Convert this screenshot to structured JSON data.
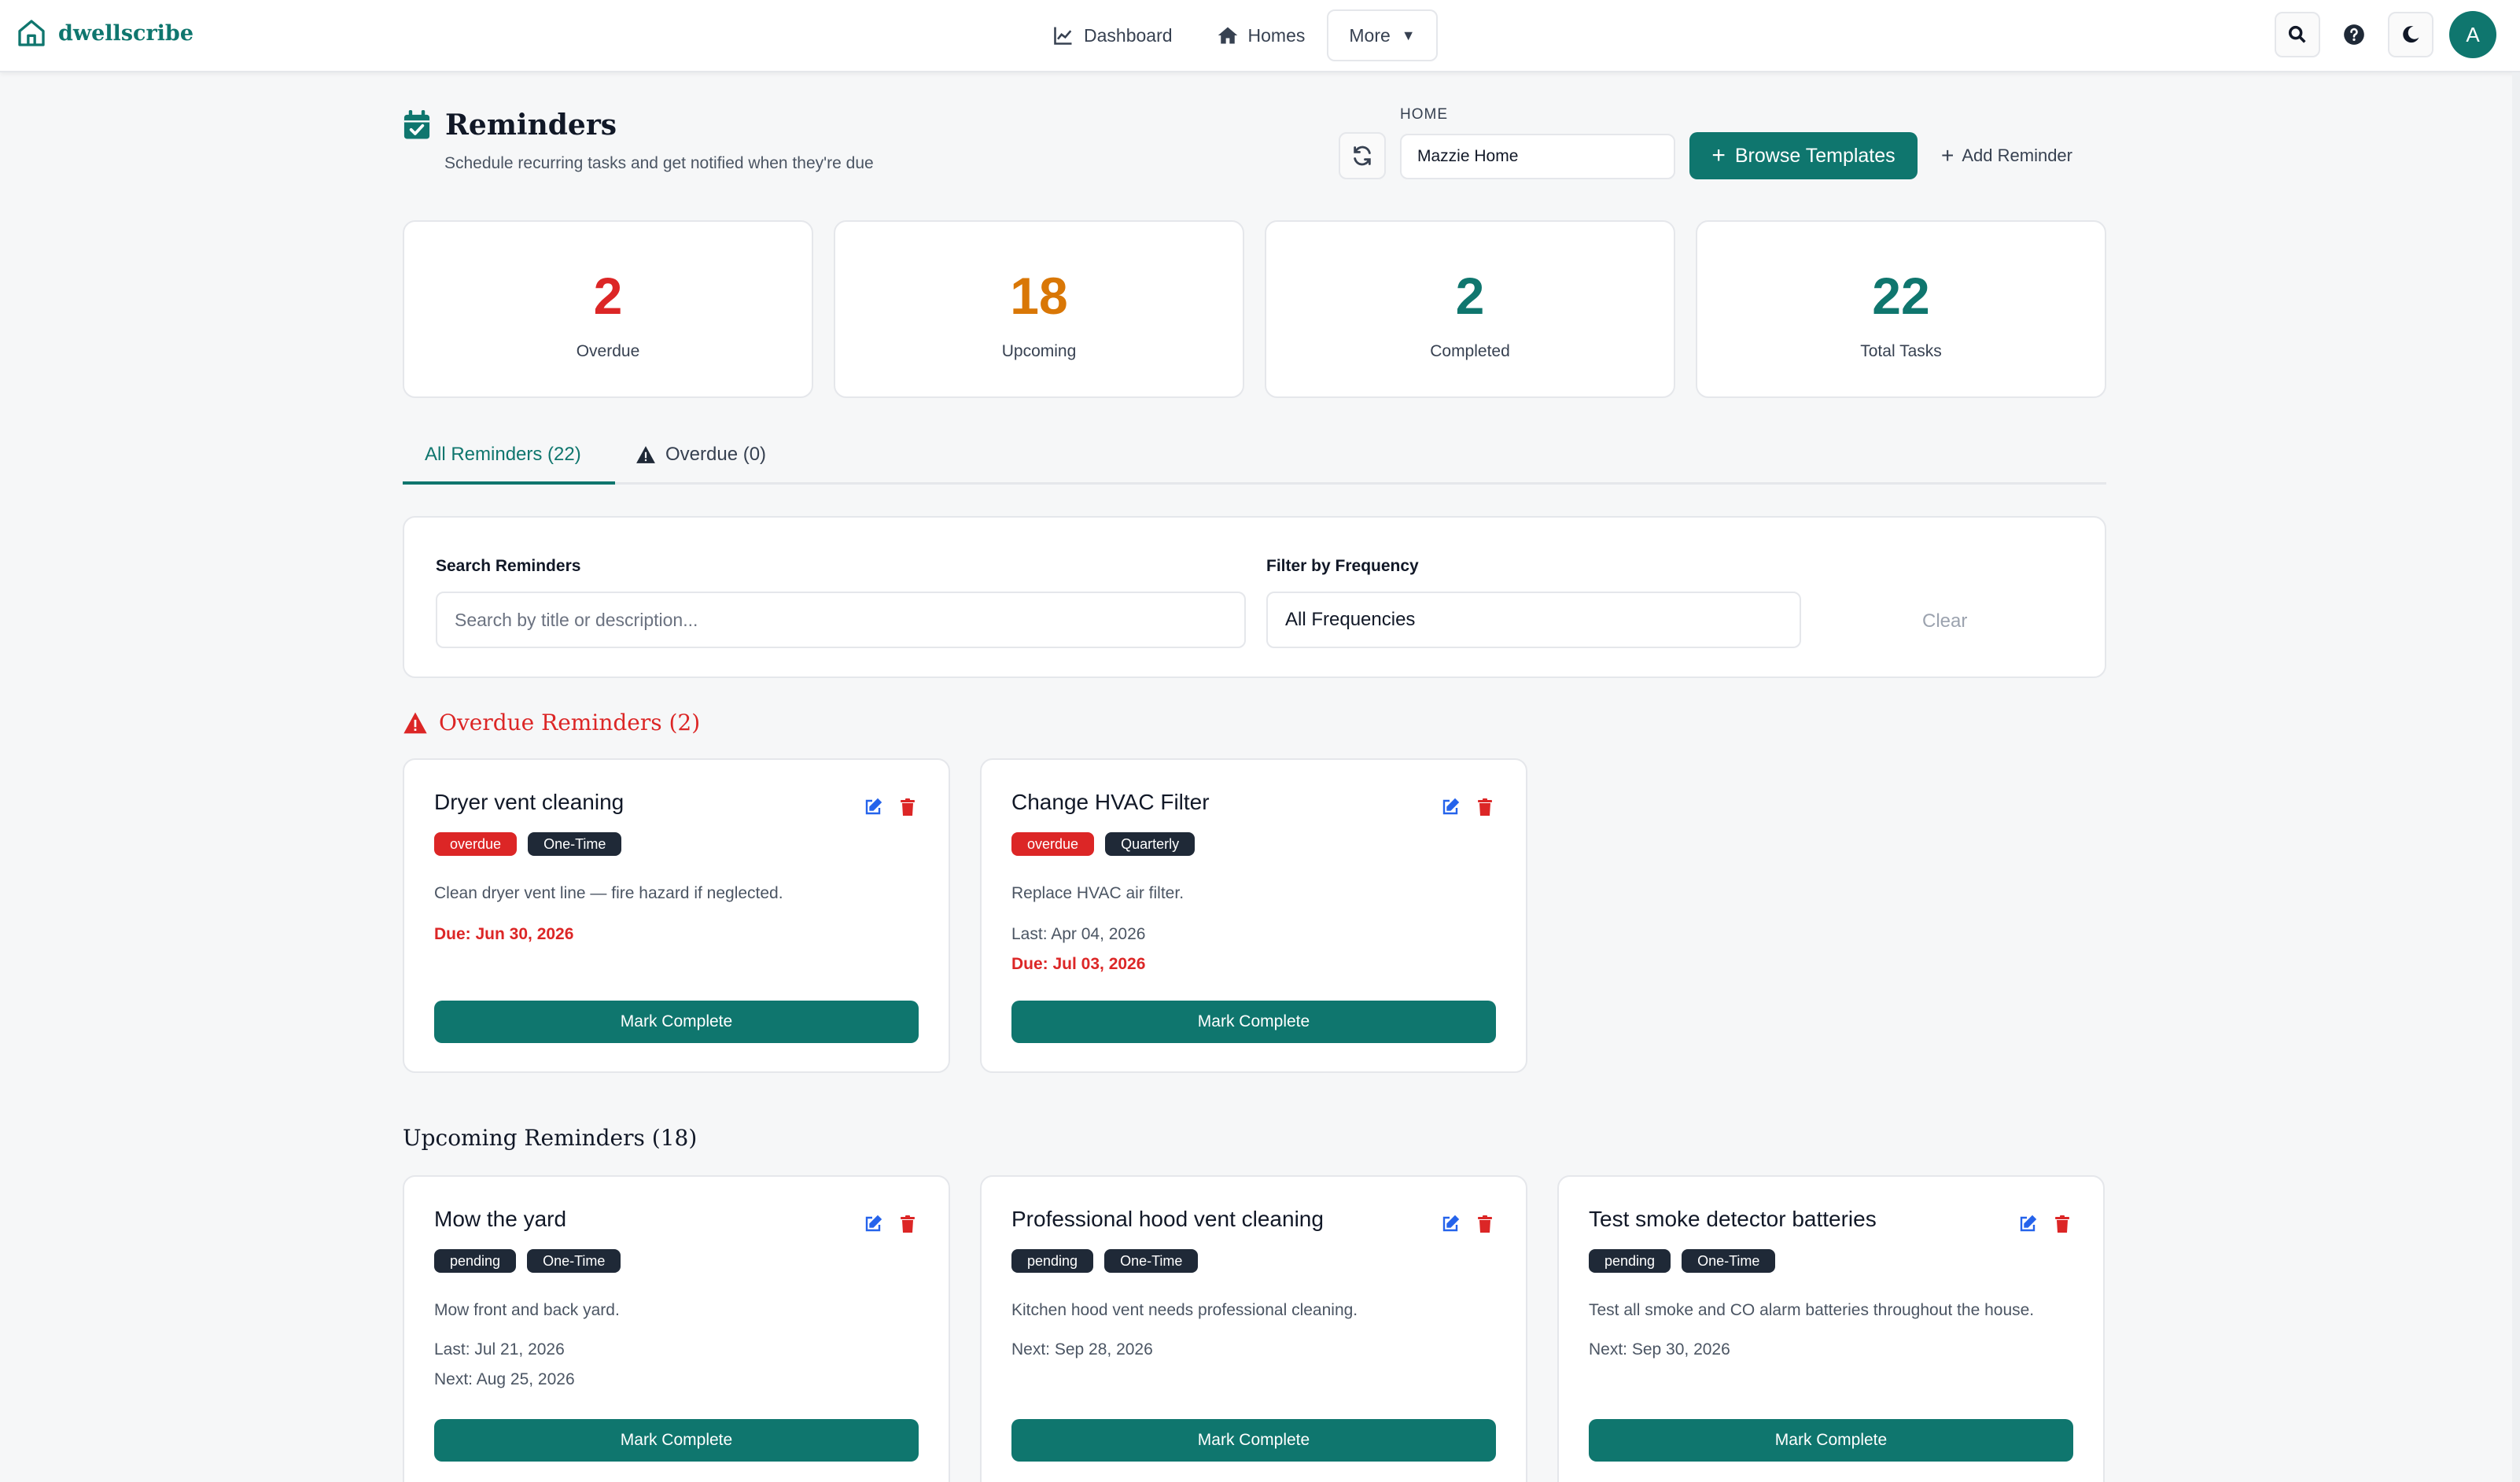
{
  "brand": {
    "name": "dwellscribe"
  },
  "nav": {
    "dashboard": "Dashboard",
    "homes": "Homes",
    "more": "More"
  },
  "user": {
    "initial": "A"
  },
  "header": {
    "title": "Reminders",
    "subtitle": "Schedule recurring tasks and get notified when they're due",
    "home_label": "HOME",
    "home_value": "Mazzie Home",
    "browse_label": "Browse Templates",
    "add_label": "Add Reminder"
  },
  "stats": [
    {
      "value": "2",
      "label": "Overdue",
      "color": "#dc2626"
    },
    {
      "value": "18",
      "label": "Upcoming",
      "color": "#d97706"
    },
    {
      "value": "2",
      "label": "Completed",
      "color": "#0f766e"
    },
    {
      "value": "22",
      "label": "Total Tasks",
      "color": "#0f766e"
    }
  ],
  "tabs": {
    "all": "All Reminders (22)",
    "overdue": "Overdue (0)"
  },
  "filters": {
    "search_label": "Search Reminders",
    "search_placeholder": "Search by title or description...",
    "frequency_label": "Filter by Frequency",
    "frequency_value": "All Frequencies",
    "clear_label": "Clear"
  },
  "overdue_section": {
    "title": "Overdue Reminders (2)",
    "items": [
      {
        "title": "Dryer vent cleaning",
        "status": "overdue",
        "frequency": "One-Time",
        "description": "Clean dryer vent line — fire hazard if neglected.",
        "due": "Due: Jun 30, 2026",
        "action": "Mark Complete"
      },
      {
        "title": "Change HVAC Filter",
        "status": "overdue",
        "frequency": "Quarterly",
        "description": "Replace HVAC air filter.",
        "last": "Last: Apr 04, 2026",
        "due": "Due: Jul 03, 2026",
        "action": "Mark Complete"
      }
    ]
  },
  "upcoming_section": {
    "title": "Upcoming Reminders (18)",
    "items": [
      {
        "title": "Mow the yard",
        "status": "pending",
        "frequency": "One-Time",
        "description": "Mow front and back yard.",
        "last": "Last: Jul 21, 2026",
        "next": "Next: Aug 25, 2026",
        "action": "Mark Complete"
      },
      {
        "title": "Professional hood vent cleaning",
        "status": "pending",
        "frequency": "One-Time",
        "description": "Kitchen hood vent needs professional cleaning.",
        "next": "Next: Sep 28, 2026",
        "action": "Mark Complete"
      },
      {
        "title": "Test smoke detector batteries",
        "status": "pending",
        "frequency": "One-Time",
        "description": "Test all smoke and CO alarm batteries throughout the house.",
        "next": "Next: Sep 30, 2026",
        "action": "Mark Complete"
      }
    ]
  },
  "colors": {
    "brand": "#0f766e",
    "danger": "#dc2626",
    "warning": "#d97706",
    "badge_dark": "#1f2937"
  }
}
